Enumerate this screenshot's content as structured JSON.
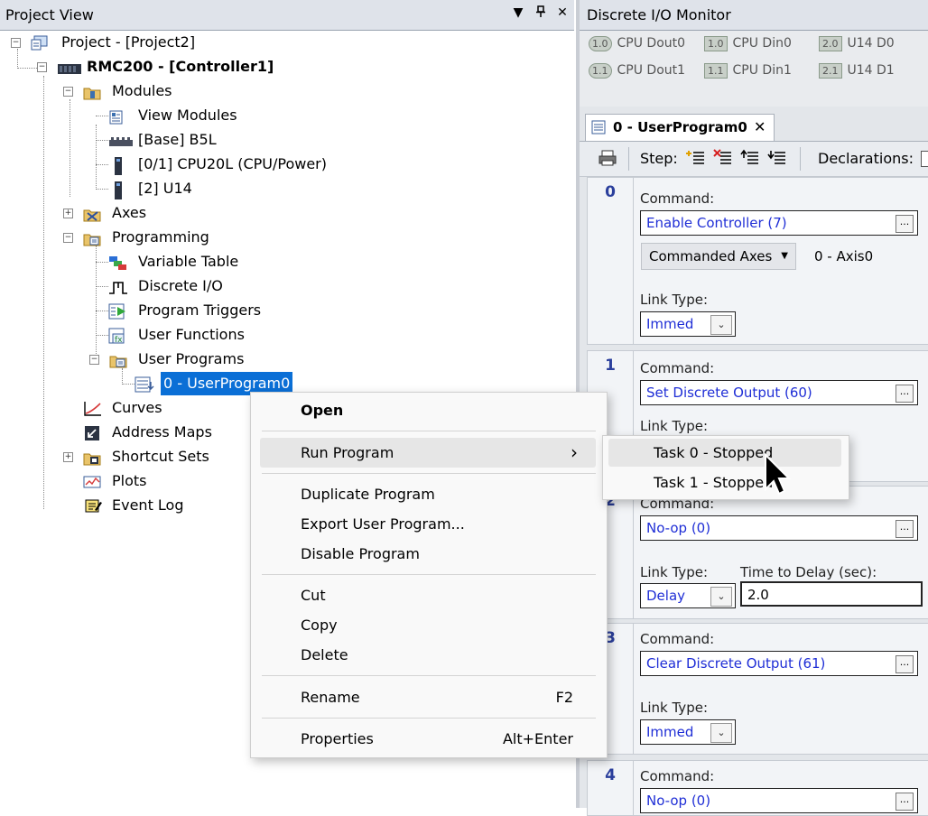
{
  "project_view": {
    "title": "Project View",
    "pin_icon": "pin-icon",
    "close_glyph": "✕",
    "dropdown_glyph": "▼",
    "tree": {
      "project": "Project - [Project2]",
      "controller": "RMC200 - [Controller1]",
      "modules": "Modules",
      "view_modules": "View Modules",
      "base": "[Base] B5L",
      "cpu": "[0/1] CPU20L (CPU/Power)",
      "u14": "[2] U14",
      "axes": "Axes",
      "programming": "Programming",
      "variable_table": "Variable Table",
      "discrete_io": "Discrete I/O",
      "program_triggers": "Program Triggers",
      "user_functions": "User Functions",
      "user_programs": "User Programs",
      "user_program0": "0 - UserProgram0",
      "curves": "Curves",
      "address_maps": "Address Maps",
      "shortcut_sets": "Shortcut Sets",
      "plots": "Plots",
      "event_log": "Event Log"
    }
  },
  "discrete_io_monitor": {
    "title": "Discrete I/O Monitor",
    "items": [
      {
        "badge": "1.0",
        "label": "CPU Dout0"
      },
      {
        "badge": "1.0",
        "label": "CPU Din0"
      },
      {
        "badge": "2.0",
        "label": "U14 D0"
      },
      {
        "badge": "1.1",
        "label": "CPU Dout1"
      },
      {
        "badge": "1.1",
        "label": "CPU Din1"
      },
      {
        "badge": "2.1",
        "label": "U14 D1"
      }
    ]
  },
  "program_editor": {
    "tab_label": "0 - UserProgram0",
    "tab_close": "✕",
    "toolbar": {
      "step_label": "Step:",
      "declarations_label": "Declarations:"
    },
    "steps": [
      {
        "num": "0",
        "command_label": "Command:",
        "command": "Enable Controller (7)",
        "axes_button": "Commanded Axes",
        "axes_value": "0 - Axis0",
        "link_label": "Link Type:",
        "link": "Immed"
      },
      {
        "num": "1",
        "command_label": "Command:",
        "command": "Set Discrete Output (60)",
        "link_label": "Link Type:"
      },
      {
        "num": "2",
        "command_label": "Command:",
        "command": "No-op (0)",
        "link_label": "Link Type:",
        "link": "Delay",
        "delay_label": "Time to Delay (sec):",
        "delay": "2.0"
      },
      {
        "num": "3",
        "command_label": "Command:",
        "command": "Clear Discrete Output (61)",
        "link_label": "Link Type:",
        "link": "Immed"
      },
      {
        "num": "4",
        "command_label": "Command:",
        "command": "No-op (0)"
      }
    ],
    "dots": "...",
    "dropdown_glyph": "⌄"
  },
  "context_menu": {
    "open": "Open",
    "run_program": "Run Program",
    "submenu_arrow": "›",
    "duplicate": "Duplicate Program",
    "export": "Export User Program...",
    "disable": "Disable Program",
    "cut": "Cut",
    "copy": "Copy",
    "delete": "Delete",
    "rename": "Rename",
    "rename_key": "F2",
    "properties": "Properties",
    "properties_key": "Alt+Enter"
  },
  "run_submenu": {
    "task0": "Task 0 - Stopped",
    "task1": "Task 1 - Stopped"
  }
}
